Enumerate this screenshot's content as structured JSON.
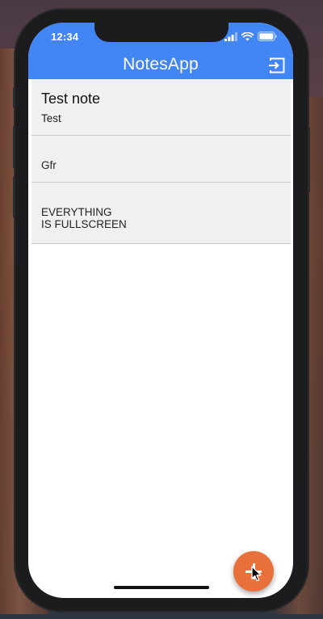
{
  "status_bar": {
    "time": "12:34",
    "signal_icon": "signal-bars-icon",
    "wifi_icon": "wifi-icon",
    "battery_icon": "battery-icon"
  },
  "app_bar": {
    "title": "NotesApp",
    "logout_icon": "logout-icon",
    "color": "#4285f4"
  },
  "notes": [
    {
      "title": "Test note",
      "body": "Test"
    },
    {
      "title": "",
      "body": "Gfr"
    },
    {
      "title": "",
      "body": "EVERYTHING\nIS FULLSCREEN"
    }
  ],
  "fab": {
    "icon": "plus-icon",
    "color": "#e8703a"
  }
}
